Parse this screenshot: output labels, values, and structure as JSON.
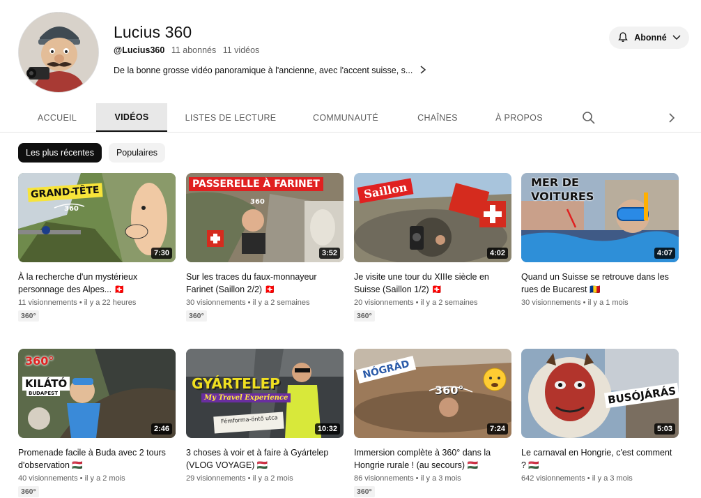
{
  "channel": {
    "name": "Lucius 360",
    "handle": "@Lucius360",
    "subscribers": "11 abonnés",
    "videos_count": "11 vidéos",
    "description": "De la bonne grosse vidéo panoramique à l'ancienne, avec l'accent suisse, s..."
  },
  "subscribe": {
    "label": "Abonné",
    "icon": "bell-icon"
  },
  "tabs": [
    {
      "label": "ACCUEIL"
    },
    {
      "label": "VIDÉOS"
    },
    {
      "label": "LISTES DE LECTURE"
    },
    {
      "label": "COMMUNAUTÉ"
    },
    {
      "label": "CHAÎNES"
    },
    {
      "label": "À PROPOS"
    }
  ],
  "chips": [
    {
      "label": "Les plus récentes",
      "selected": true
    },
    {
      "label": "Populaires",
      "selected": false
    }
  ],
  "videos": [
    {
      "thumb_text": "GRAND-TÊTE",
      "duration": "7:30",
      "title": "À la recherche d'un mystérieux personnage des Alpes... 🇨🇭",
      "views": "11 visionnements",
      "age": "il y a 22 heures",
      "badge": "360°"
    },
    {
      "thumb_text": "PASSERELLE À FARINET",
      "duration": "3:52",
      "title": "Sur les traces du faux-monnayeur Farinet (Saillon 2/2) 🇨🇭",
      "views": "30 visionnements",
      "age": "il y a 2 semaines",
      "badge": "360°"
    },
    {
      "thumb_text": "Saillon",
      "duration": "4:02",
      "title": "Je visite une tour du XIIIe siècle en Suisse (Saillon 1/2) 🇨🇭",
      "views": "20 visionnements",
      "age": "il y a 2 semaines",
      "badge": "360°"
    },
    {
      "thumb_text": "MER DE VOITURES",
      "duration": "4:07",
      "title": "Quand un Suisse se retrouve dans les rues de Bucarest 🇷🇴",
      "views": "30 visionnements",
      "age": "il y a 1 mois",
      "badge": ""
    },
    {
      "thumb_text": "KILÁTÓ",
      "duration": "2:46",
      "title": "Promenade facile à Buda avec 2 tours d'observation 🇭🇺",
      "views": "40 visionnements",
      "age": "il y a 2 mois",
      "badge": "360°"
    },
    {
      "thumb_text": "GYÁRTELEP",
      "duration": "10:32",
      "title": "3 choses à voir et à faire à Gyártelep (VLOG VOYAGE) 🇭🇺",
      "views": "29 visionnements",
      "age": "il y a 2 mois",
      "badge": ""
    },
    {
      "thumb_text": "NÓGRÁD",
      "duration": "7:24",
      "title": "Immersion complète à 360° dans la Hongrie rurale ! (au secours) 🇭🇺",
      "views": "86 visionnements",
      "age": "il y a 3 mois",
      "badge": "360°"
    },
    {
      "thumb_text": "BUSÓJÁRÁS",
      "duration": "5:03",
      "title": "Le carnaval en Hongrie, c'est comment ? 🇭🇺",
      "views": "642 visionnements",
      "age": "il y a 3 mois",
      "badge": ""
    }
  ],
  "thumb_labels": {
    "grandtete_sub": "360",
    "farinet_sub": "360",
    "kilato_top": "360°",
    "kilato_sub": "BUDAPEST",
    "gyartelep_sub": "My Travel Experience",
    "gyartelep_sign": "Fémforma-öntő utca",
    "nograd_360": "360°"
  },
  "colors": {
    "accent": "#0f0f0f",
    "chip_bg": "#f2f2f2",
    "muted": "#606060"
  }
}
